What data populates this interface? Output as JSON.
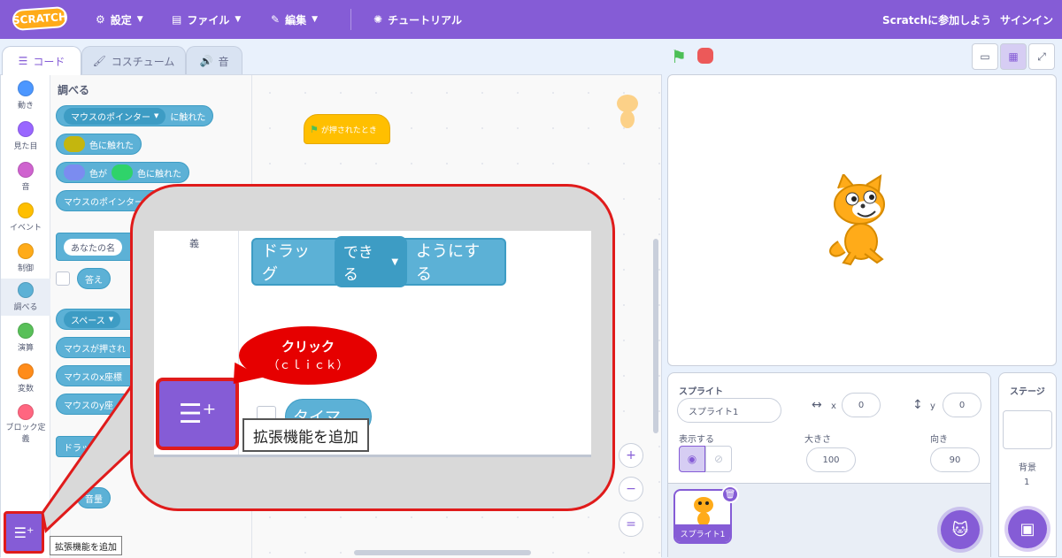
{
  "menubar": {
    "logo": "SCRATCH",
    "settings": "設定",
    "file": "ファイル",
    "edit": "編集",
    "tutorials": "チュートリアル",
    "join": "Scratchに参加しよう",
    "signin": "サインイン"
  },
  "tabs": {
    "code": "コード",
    "costumes": "コスチューム",
    "sounds": "音"
  },
  "categories": [
    {
      "label": "動き",
      "color": "#4c97ff"
    },
    {
      "label": "見た目",
      "color": "#9966ff"
    },
    {
      "label": "音",
      "color": "#cf63cf"
    },
    {
      "label": "イベント",
      "color": "#ffbf00"
    },
    {
      "label": "制御",
      "color": "#ffab19"
    },
    {
      "label": "調べる",
      "color": "#5cb1d6"
    },
    {
      "label": "演算",
      "color": "#59c059"
    },
    {
      "label": "変数",
      "color": "#ff8c1a"
    },
    {
      "label": "ブロック定義",
      "color": "#ff6680"
    }
  ],
  "palette": {
    "title": "調べる",
    "blocks": {
      "touching_pointer": "マウスのポインター",
      "touching_suffix": "に触れた",
      "color_touching": "色に触れた",
      "color_is": "色が",
      "color_touching2": "色に触れた",
      "distance": "マウスのポインター",
      "ask": "あなたの名",
      "answer": "答え",
      "key_space": "スペース",
      "mouse_down": "マウスが押され",
      "mouse_x": "マウスのx座標",
      "mouse_y": "マウスのy座",
      "drag": "ドラッ",
      "loudness": "音量"
    }
  },
  "workspace": {
    "hat_block": "が押されたとき"
  },
  "extension": {
    "tooltip": "拡張機能を追加"
  },
  "callout": {
    "drag_block_prefix": "ドラッグ",
    "drag_block_option": "できる",
    "drag_block_suffix": "ようにする",
    "partial_block": "タイマ",
    "bubble_line1": "クリック",
    "bubble_line2": "（ｃｌｉｃｋ）",
    "tooltip": "拡張機能を追加"
  },
  "sprite_info": {
    "sprite_label": "スプライト",
    "sprite_name": "スプライト1",
    "x_label": "x",
    "x_value": "0",
    "y_label": "y",
    "y_value": "0",
    "show_label": "表示する",
    "size_label": "大きさ",
    "size_value": "100",
    "direction_label": "向き",
    "direction_value": "90",
    "thumb_name": "スプライト1"
  },
  "stage_panel": {
    "title": "ステージ",
    "backdrops_label": "背景",
    "backdrops_count": "1"
  }
}
